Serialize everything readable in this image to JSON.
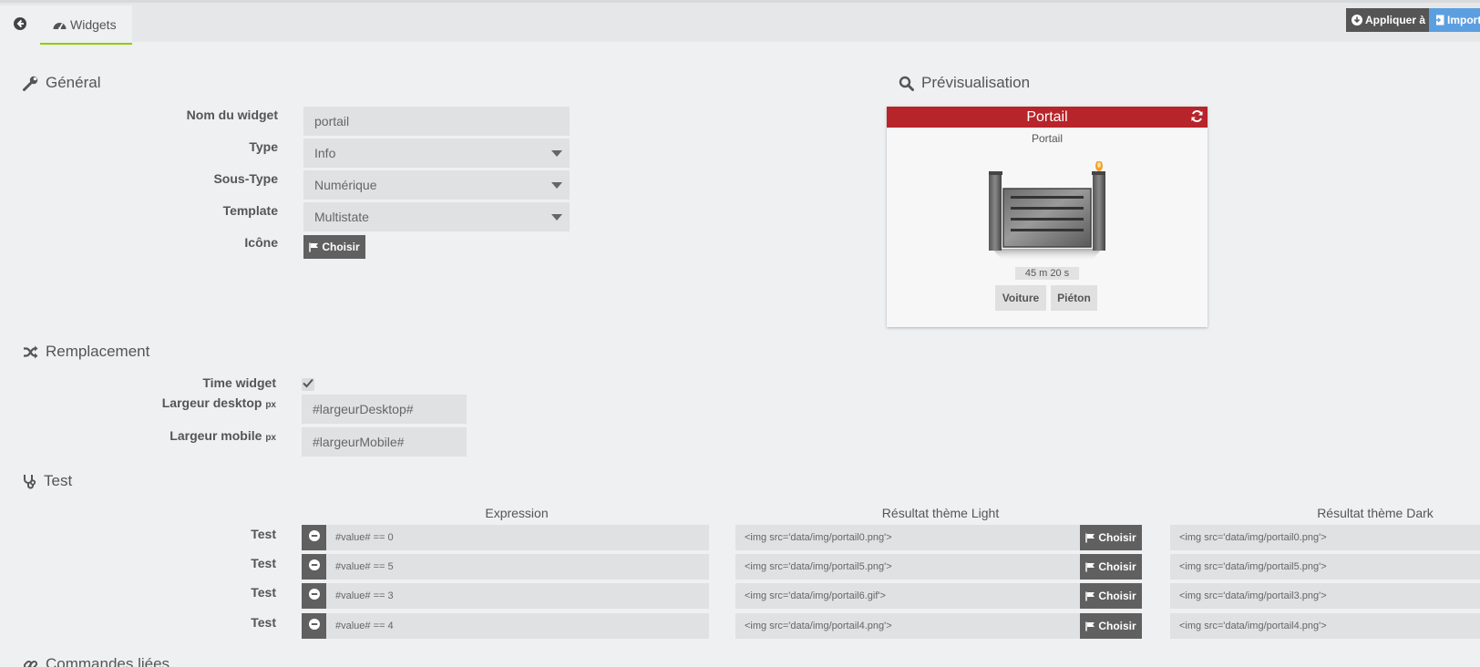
{
  "tabs": {
    "widgets_label": "Widgets"
  },
  "toolbar": {
    "apply_label": "Appliquer à",
    "import_label": "Import"
  },
  "general": {
    "title": "Général",
    "name_label": "Nom du widget",
    "name_value": "portail",
    "type_label": "Type",
    "type_value": "Info",
    "subtype_label": "Sous-Type",
    "subtype_value": "Numérique",
    "template_label": "Template",
    "template_value": "Multistate",
    "icon_label": "Icône",
    "icon_button": "Choisir"
  },
  "preview": {
    "title": "Prévisualisation",
    "header": "Portail",
    "name": "Portail",
    "timer": "45 m 20 s",
    "btn_car": "Voiture",
    "btn_pedestrian": "Piéton"
  },
  "replacement": {
    "title": "Remplacement",
    "time_widget_label": "Time widget",
    "time_widget_checked": true,
    "desktop_label": "Largeur desktop",
    "desktop_unit": "px",
    "desktop_value": "#largeurDesktop#",
    "mobile_label": "Largeur mobile",
    "mobile_unit": "px",
    "mobile_value": "#largeurMobile#"
  },
  "test": {
    "title": "Test",
    "col_expression": "Expression",
    "col_light": "Résultat thème Light",
    "col_dark": "Résultat thème Dark",
    "choose_label": "Choisir",
    "rows": [
      {
        "label": "Test",
        "expression": "#value# == 0",
        "light": "<img src='data/img/portail0.png'>",
        "dark": "<img src='data/img/portail0.png'>"
      },
      {
        "label": "Test",
        "expression": "#value# == 5",
        "light": "<img src='data/img/portail5.png'>",
        "dark": "<img src='data/img/portail5.png'>"
      },
      {
        "label": "Test",
        "expression": "#value# == 3",
        "light": "<img src='data/img/portail6.gif'>",
        "dark": "<img src='data/img/portail3.png'>"
      },
      {
        "label": "Test",
        "expression": "#value# == 4",
        "light": "<img src='data/img/portail4.png'>",
        "dark": "<img src='data/img/portail4.png'>"
      }
    ]
  },
  "linked": {
    "title": "Commandes liées"
  },
  "colors": {
    "accent_green": "#93ca02",
    "header_red": "#b7242a",
    "import_blue": "#5c9fe0",
    "dark_button": "#606060"
  },
  "icons": [
    "back-arrow-icon",
    "dashboard-icon",
    "download-icon",
    "import-icon",
    "wrench-icon",
    "search-icon",
    "refresh-icon",
    "shuffle-icon",
    "stethoscope-icon",
    "flag-icon",
    "minus-icon",
    "link-icon",
    "check-icon"
  ]
}
